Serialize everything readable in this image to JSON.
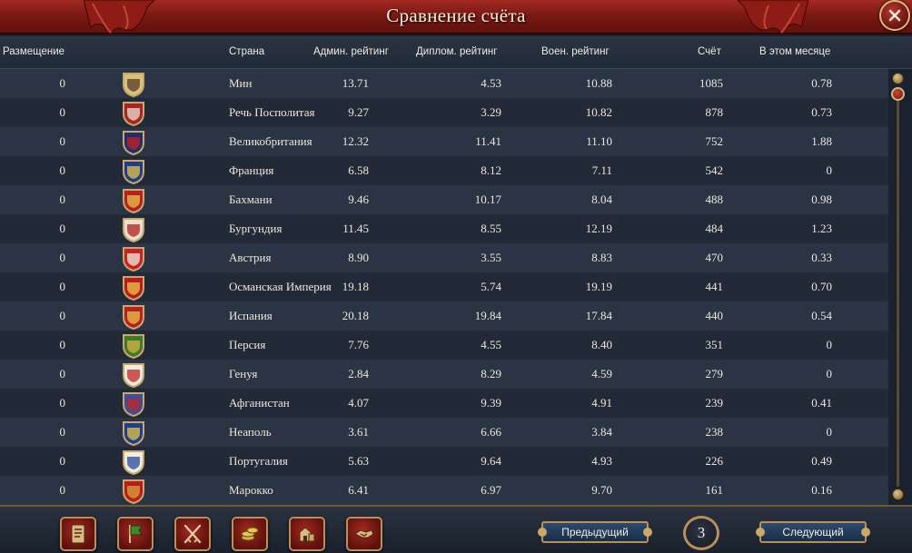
{
  "window": {
    "title": "Сравнение счёта"
  },
  "columns": {
    "placement": "Размещение",
    "country": "Страна",
    "admin": "Админ. рейтинг",
    "diplo": "Диплом. рейтинг",
    "mil": "Воен. рейтинг",
    "score": "Счёт",
    "month": "В этом месяце"
  },
  "rows": [
    {
      "placement": "0",
      "country": "Мин",
      "admin": "13.71",
      "diplo": "4.53",
      "mil": "10.88",
      "score": "1085",
      "month": "0.78",
      "flag": "ming-flag-icon",
      "flag_colors": [
        "#d8c27a",
        "#5a3a2a"
      ]
    },
    {
      "placement": "0",
      "country": "Речь Посполитая",
      "admin": "9.27",
      "diplo": "3.29",
      "mil": "10.82",
      "score": "878",
      "month": "0.73",
      "flag": "poland-lithuania-flag-icon",
      "flag_colors": [
        "#a52424",
        "#e8e0d0"
      ]
    },
    {
      "placement": "0",
      "country": "Великобритания",
      "admin": "12.32",
      "diplo": "11.41",
      "mil": "11.10",
      "score": "752",
      "month": "1.88",
      "flag": "great-britain-flag-icon",
      "flag_colors": [
        "#1e2f6e",
        "#c52020"
      ]
    },
    {
      "placement": "0",
      "country": "Франция",
      "admin": "6.58",
      "diplo": "8.12",
      "mil": "7.11",
      "score": "542",
      "month": "0",
      "flag": "france-flag-icon",
      "flag_colors": [
        "#1e3f8f",
        "#e6c448"
      ]
    },
    {
      "placement": "0",
      "country": "Бахмани",
      "admin": "9.46",
      "diplo": "10.17",
      "mil": "8.04",
      "score": "488",
      "month": "0.98",
      "flag": "bahmani-flag-icon",
      "flag_colors": [
        "#b82020",
        "#e6c448"
      ]
    },
    {
      "placement": "0",
      "country": "Бургундия",
      "admin": "11.45",
      "diplo": "8.55",
      "mil": "12.19",
      "score": "484",
      "month": "1.23",
      "flag": "burgundy-flag-icon",
      "flag_colors": [
        "#e8e0d0",
        "#b82020"
      ]
    },
    {
      "placement": "0",
      "country": "Австрия",
      "admin": "8.90",
      "diplo": "3.55",
      "mil": "8.83",
      "score": "470",
      "month": "0.33",
      "flag": "austria-flag-icon",
      "flag_colors": [
        "#c42424",
        "#f0ece0"
      ]
    },
    {
      "placement": "0",
      "country": "Османская Империя",
      "admin": "19.18",
      "diplo": "5.74",
      "mil": "19.19",
      "score": "441",
      "month": "0.70",
      "flag": "ottoman-flag-icon",
      "flag_colors": [
        "#b81c1c",
        "#e6c448"
      ]
    },
    {
      "placement": "0",
      "country": "Испания",
      "admin": "20.18",
      "diplo": "19.84",
      "mil": "17.84",
      "score": "440",
      "month": "0.54",
      "flag": "spain-flag-icon",
      "flag_colors": [
        "#b82020",
        "#e6c448"
      ]
    },
    {
      "placement": "0",
      "country": "Персия",
      "admin": "7.76",
      "diplo": "4.55",
      "mil": "8.40",
      "score": "351",
      "month": "0",
      "flag": "persia-flag-icon",
      "flag_colors": [
        "#3e7a2a",
        "#d8b448"
      ]
    },
    {
      "placement": "0",
      "country": "Генуя",
      "admin": "2.84",
      "diplo": "8.29",
      "mil": "4.59",
      "score": "279",
      "month": "0",
      "flag": "genoa-flag-icon",
      "flag_colors": [
        "#f0ece0",
        "#c42424"
      ]
    },
    {
      "placement": "0",
      "country": "Афганистан",
      "admin": "4.07",
      "diplo": "9.39",
      "mil": "4.91",
      "score": "239",
      "month": "0.41",
      "flag": "afghanistan-flag-icon",
      "flag_colors": [
        "#3a4e9a",
        "#c42424"
      ]
    },
    {
      "placement": "0",
      "country": "Неаполь",
      "admin": "3.61",
      "diplo": "6.66",
      "mil": "3.84",
      "score": "238",
      "month": "0",
      "flag": "naples-flag-icon",
      "flag_colors": [
        "#1e3f8f",
        "#e6c448"
      ]
    },
    {
      "placement": "0",
      "country": "Португалия",
      "admin": "5.63",
      "diplo": "9.64",
      "mil": "4.93",
      "score": "226",
      "month": "0.49",
      "flag": "portugal-flag-icon",
      "flag_colors": [
        "#f0ece0",
        "#2a4a9a"
      ]
    },
    {
      "placement": "0",
      "country": "Марокко",
      "admin": "6.41",
      "diplo": "6.97",
      "mil": "9.70",
      "score": "161",
      "month": "0.16",
      "flag": "morocco-flag-icon",
      "flag_colors": [
        "#b81c1c",
        "#d8a43a"
      ]
    }
  ],
  "footer": {
    "buttons": [
      {
        "name": "ledger-icon"
      },
      {
        "name": "flag-banner-icon"
      },
      {
        "name": "crossed-swords-icon"
      },
      {
        "name": "coins-icon"
      },
      {
        "name": "buildings-icon"
      },
      {
        "name": "handshake-icon"
      }
    ],
    "prev_label": "Предыдущий",
    "next_label": "Следующий",
    "page": "3"
  },
  "colors": {
    "title_bar": "#7c1914",
    "row_odd": "#2b3444",
    "row_even": "#222a38",
    "gold_trim": "#b89058"
  }
}
